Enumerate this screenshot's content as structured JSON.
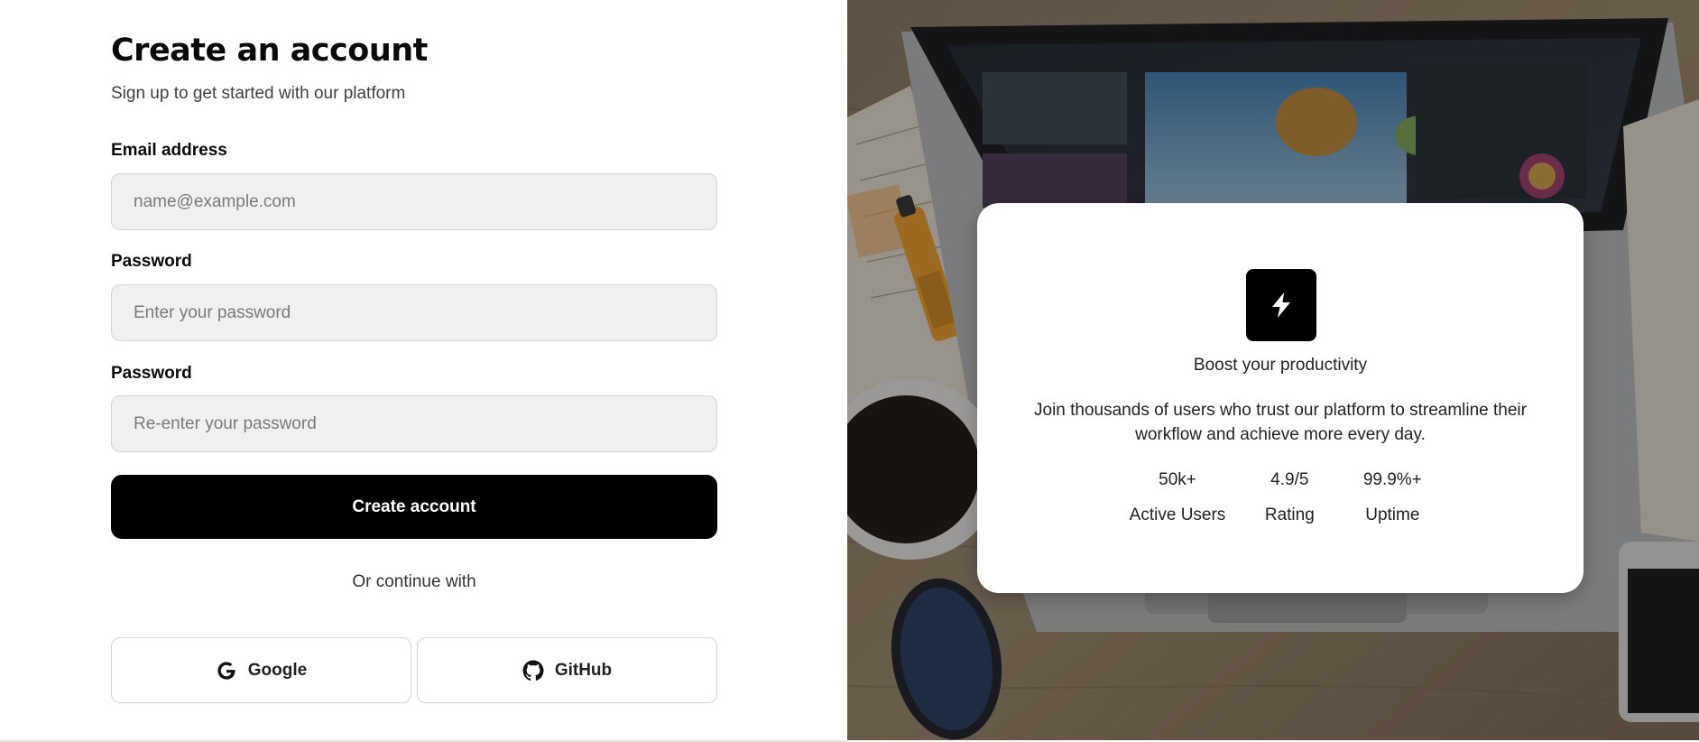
{
  "signup": {
    "title": "Create an account",
    "subtitle": "Sign up to get started with our platform",
    "email": {
      "label": "Email address",
      "placeholder": "name@example.com"
    },
    "password": {
      "label": "Password",
      "placeholder": "Enter your password"
    },
    "confirm_password": {
      "label": "Password",
      "placeholder": "Re-enter your password"
    },
    "submit_label": "Create account",
    "divider_text": "Or continue with",
    "social": {
      "google_label": "Google",
      "github_label": "GitHub"
    }
  },
  "promo": {
    "icon": "lightning-bolt-icon",
    "heading": "Boost your productivity",
    "description": "Join thousands of users who trust our platform to streamline their workflow and achieve more every day.",
    "stats": [
      {
        "value": "50k+",
        "label": "Active Users"
      },
      {
        "value": "4.9/5",
        "label": "Rating"
      },
      {
        "value": "99.9%+",
        "label": "Uptime"
      }
    ]
  },
  "colors": {
    "primary_button": "#000000",
    "input_background": "#f0f0f0",
    "card_background": "#ffffff"
  }
}
